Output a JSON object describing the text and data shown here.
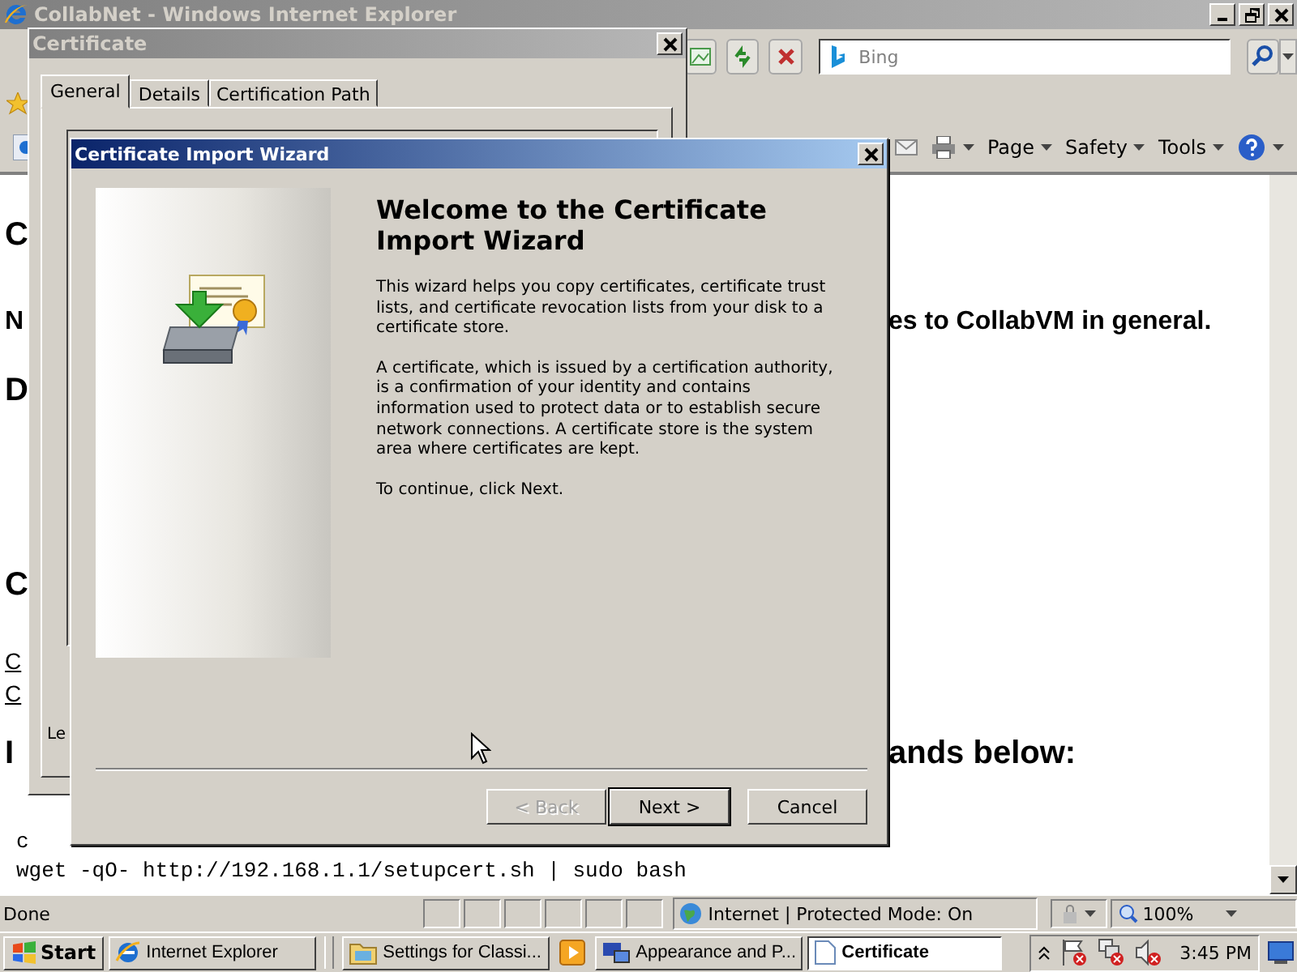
{
  "browser": {
    "title": "CollabNet - Windows Internet Explorer",
    "search": {
      "placeholder": "Bing"
    },
    "commands": [
      {
        "label": "Page"
      },
      {
        "label": "Safety"
      },
      {
        "label": "Tools"
      }
    ],
    "page_lines": [
      {
        "kind": "heading",
        "left": "C"
      },
      {
        "kind": "text",
        "left": "N",
        "right": "es to CollabVM in general."
      },
      {
        "kind": "heading",
        "left": "D"
      },
      {
        "kind": "heading",
        "left": "C"
      },
      {
        "kind": "link",
        "left": "C"
      },
      {
        "kind": "link",
        "left": "C"
      },
      {
        "kind": "heading",
        "left": "I",
        "right": "ands below:"
      },
      {
        "kind": "code",
        "left": "c"
      },
      {
        "kind": "code",
        "left": "wget -qO- http://192.168.1.1/setupcert.sh | sudo bash"
      }
    ],
    "status": {
      "text": "Done",
      "zone": "Internet | Protected Mode: On",
      "zoom": "100%"
    }
  },
  "certificate_dialog": {
    "title": "Certificate",
    "tabs": [
      {
        "label": "General",
        "selected": true
      },
      {
        "label": "Details",
        "selected": false
      },
      {
        "label": "Certification Path",
        "selected": false
      }
    ],
    "fragment": "Le"
  },
  "wizard": {
    "title": "Certificate Import Wizard",
    "heading": "Welcome to the Certificate Import Wizard",
    "paragraphs": [
      "This wizard helps you copy certificates, certificate trust lists, and certificate revocation lists from your disk to a certificate store.",
      "A certificate, which is issued by a certification authority, is a confirmation of your identity and contains information used to protect data or to establish secure network connections. A certificate store is the system area where certificates are kept.",
      "To continue, click Next."
    ],
    "buttons": [
      {
        "label": "< Back",
        "disabled": true,
        "default": false
      },
      {
        "label": "Next >",
        "disabled": false,
        "default": true
      },
      {
        "label": "Cancel",
        "disabled": false,
        "default": false
      }
    ]
  },
  "taskbar": {
    "start": "Start",
    "items": [
      {
        "label": "Internet Explorer",
        "selected": false,
        "kind": "ie"
      },
      {
        "label": "Settings for Classi...",
        "selected": false,
        "kind": "folder"
      },
      {
        "selected": false,
        "kind": "media"
      },
      {
        "label": "Appearance and P...",
        "selected": false,
        "kind": "display"
      },
      {
        "label": "Certificate",
        "selected": true,
        "kind": "doc"
      }
    ],
    "clock": "3:45 PM"
  }
}
